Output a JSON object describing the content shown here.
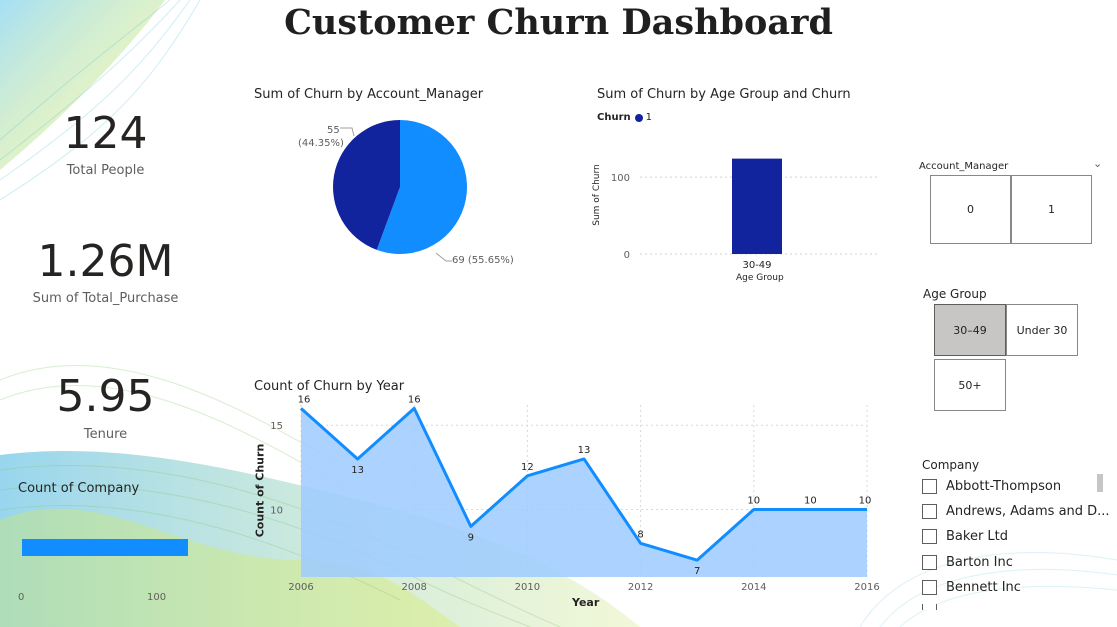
{
  "title": "Customer Churn Dashboard",
  "kpis": {
    "total_people": {
      "value": "124",
      "label": "Total People"
    },
    "total_purchase": {
      "value": "1.26M",
      "label": "Sum of Total_Purchase"
    },
    "tenure": {
      "value": "5.95",
      "label": "Tenure"
    }
  },
  "count_company": {
    "title": "Count of Company",
    "bar_value": 100,
    "axis_min": "0",
    "axis_max": "100",
    "color": "#118DFF"
  },
  "pie": {
    "title": "Sum of Churn by Account_Manager",
    "labels": [
      "55\n(44.35%)",
      "69 (55.65%)"
    ],
    "label_a_line1": "55",
    "label_a_line2": "(44.35%)",
    "label_b": "69 (55.65%)"
  },
  "age_bar": {
    "title": "Sum of Churn by Age Group and Churn",
    "legend_title": "Churn",
    "legend_item": "1",
    "ylabel": "Sum of Churn",
    "xlabel": "Age Group",
    "tick_100": "100",
    "tick_0": "0",
    "category": "30-49"
  },
  "line": {
    "title": "Count of Churn by Year",
    "xlabel": "Year",
    "ylabel": "Count of Churn",
    "xticks": [
      "2006",
      "2008",
      "2010",
      "2012",
      "2014",
      "2016"
    ],
    "yticks": [
      "15",
      "10"
    ]
  },
  "slicers": {
    "account_manager": {
      "title": "Account_Manager",
      "options": [
        "0",
        "1"
      ]
    },
    "age_group": {
      "title": "Age Group",
      "options": [
        "30–49",
        "Under 30",
        "50+"
      ],
      "selected": "30–49"
    },
    "company": {
      "title": "Company",
      "items": [
        "Abbott-Thompson",
        "Andrews, Adams and D...",
        "Baker Ltd",
        "Barton Inc",
        "Bennett Inc"
      ]
    }
  },
  "colors": {
    "dark_blue": "#12239E",
    "light_blue": "#118DFF",
    "area_fill": "#9ECBFF"
  },
  "chart_data": [
    {
      "type": "pie",
      "title": "Sum of Churn by Account_Manager",
      "categories": [
        "0",
        "1"
      ],
      "values": [
        55,
        69
      ],
      "percentages": [
        44.35,
        55.65
      ],
      "colors": [
        "#12239E",
        "#118DFF"
      ]
    },
    {
      "type": "bar",
      "title": "Sum of Churn by Age Group and Churn",
      "categories": [
        "30-49"
      ],
      "series": [
        {
          "name": "1",
          "values": [
            124
          ]
        }
      ],
      "xlabel": "Age Group",
      "ylabel": "Sum of Churn",
      "ylim": [
        0,
        130
      ]
    },
    {
      "type": "area",
      "title": "Count of Churn by Year",
      "x": [
        2006,
        2007,
        2008,
        2009,
        2010,
        2011,
        2012,
        2013,
        2014,
        2015,
        2016
      ],
      "values": [
        16,
        13,
        16,
        9,
        12,
        13,
        8,
        7,
        10,
        10,
        10
      ],
      "xlabel": "Year",
      "ylabel": "Count of Churn",
      "xlim": [
        2006,
        2016
      ],
      "ylim": [
        6,
        16.2
      ]
    }
  ]
}
